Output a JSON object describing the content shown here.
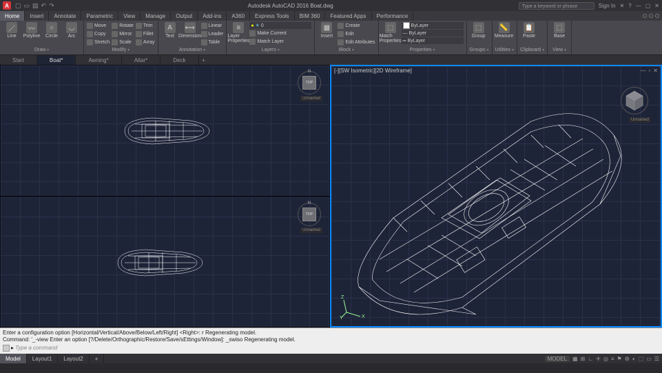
{
  "title": "Autodesk AutoCAD 2016   Boat.dwg",
  "search_placeholder": "Type a keyword or phrase",
  "signin": "Sign In",
  "menutabs": [
    "Home",
    "Insert",
    "Annotate",
    "Parametric",
    "View",
    "Manage",
    "Output",
    "Add-ins",
    "A360",
    "Express Tools",
    "BIM 360",
    "Featured Apps",
    "Performance"
  ],
  "ribbon": {
    "draw": {
      "title": "Draw",
      "items": [
        "Line",
        "Polyline",
        "Circle",
        "Arc"
      ]
    },
    "modify": {
      "title": "Modify",
      "rows": [
        [
          "Move",
          "Rotate",
          "Trim"
        ],
        [
          "Copy",
          "Mirror",
          "Fillet"
        ],
        [
          "Stretch",
          "Scale",
          "Array"
        ]
      ]
    },
    "annotation": {
      "title": "Annotation",
      "big": "Text",
      "rows": [
        "Linear",
        "Leader",
        "Table"
      ],
      "dim": "Dimension"
    },
    "layers": {
      "title": "Layers",
      "big": "Layer Properties",
      "current": "0"
    },
    "block": {
      "title": "Block",
      "big": "Insert",
      "rows": [
        "Create",
        "Edit",
        "Edit Attributes"
      ]
    },
    "properties": {
      "title": "Properties",
      "big": "Match Properties",
      "rows": [
        "ByLayer",
        "ByLayer",
        "ByLayer"
      ],
      "make": "Make Current",
      "match": "Match Layer"
    },
    "groups": {
      "title": "Groups",
      "big": "Group"
    },
    "utilities": {
      "title": "Utilities",
      "big": "Measure"
    },
    "clipboard": {
      "title": "Clipboard",
      "big": "Paste"
    },
    "view": {
      "title": "View",
      "big": "Base"
    }
  },
  "doctabs": [
    "Start",
    "Boat*",
    "Awning*",
    "Altar*",
    "Deck"
  ],
  "viewport_label": "[-][SW Isometric][2D Wireframe]",
  "viewcube_face": "TOP",
  "vc_unnamed": "Unnamed",
  "axes": {
    "x": "X",
    "y": "Y",
    "z": "Z"
  },
  "cmd": {
    "line1": "Enter a configuration option [Horizontal/Vertical/Above/Below/Left/Right] <Right>: r Regenerating model.",
    "line2": "Command: '_-view Enter an option [?/Delete/Orthographic/Restore/Save/sEttings/Window]: _swiso Regenerating model.",
    "prompt": "Type a command"
  },
  "layout_tabs": [
    "Model",
    "Layout1",
    "Layout2"
  ],
  "status_model": "MODEL"
}
